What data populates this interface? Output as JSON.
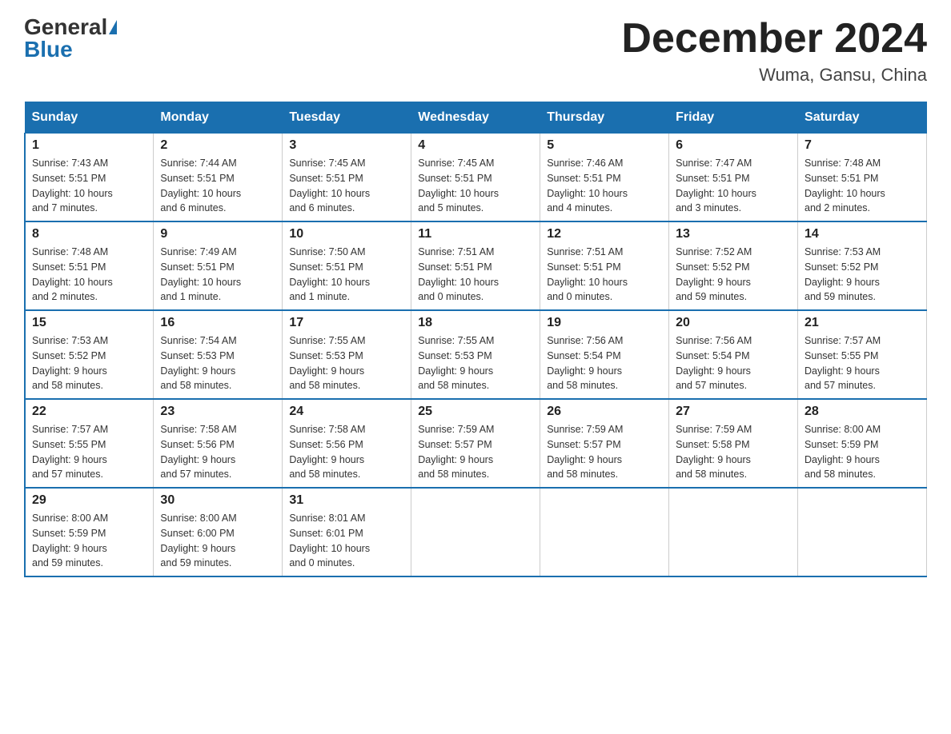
{
  "header": {
    "logo_general": "General",
    "logo_blue": "Blue",
    "month_year": "December 2024",
    "location": "Wuma, Gansu, China"
  },
  "days_of_week": [
    "Sunday",
    "Monday",
    "Tuesday",
    "Wednesday",
    "Thursday",
    "Friday",
    "Saturday"
  ],
  "weeks": [
    [
      {
        "day": "1",
        "info": "Sunrise: 7:43 AM\nSunset: 5:51 PM\nDaylight: 10 hours\nand 7 minutes."
      },
      {
        "day": "2",
        "info": "Sunrise: 7:44 AM\nSunset: 5:51 PM\nDaylight: 10 hours\nand 6 minutes."
      },
      {
        "day": "3",
        "info": "Sunrise: 7:45 AM\nSunset: 5:51 PM\nDaylight: 10 hours\nand 6 minutes."
      },
      {
        "day": "4",
        "info": "Sunrise: 7:45 AM\nSunset: 5:51 PM\nDaylight: 10 hours\nand 5 minutes."
      },
      {
        "day": "5",
        "info": "Sunrise: 7:46 AM\nSunset: 5:51 PM\nDaylight: 10 hours\nand 4 minutes."
      },
      {
        "day": "6",
        "info": "Sunrise: 7:47 AM\nSunset: 5:51 PM\nDaylight: 10 hours\nand 3 minutes."
      },
      {
        "day": "7",
        "info": "Sunrise: 7:48 AM\nSunset: 5:51 PM\nDaylight: 10 hours\nand 2 minutes."
      }
    ],
    [
      {
        "day": "8",
        "info": "Sunrise: 7:48 AM\nSunset: 5:51 PM\nDaylight: 10 hours\nand 2 minutes."
      },
      {
        "day": "9",
        "info": "Sunrise: 7:49 AM\nSunset: 5:51 PM\nDaylight: 10 hours\nand 1 minute."
      },
      {
        "day": "10",
        "info": "Sunrise: 7:50 AM\nSunset: 5:51 PM\nDaylight: 10 hours\nand 1 minute."
      },
      {
        "day": "11",
        "info": "Sunrise: 7:51 AM\nSunset: 5:51 PM\nDaylight: 10 hours\nand 0 minutes."
      },
      {
        "day": "12",
        "info": "Sunrise: 7:51 AM\nSunset: 5:51 PM\nDaylight: 10 hours\nand 0 minutes."
      },
      {
        "day": "13",
        "info": "Sunrise: 7:52 AM\nSunset: 5:52 PM\nDaylight: 9 hours\nand 59 minutes."
      },
      {
        "day": "14",
        "info": "Sunrise: 7:53 AM\nSunset: 5:52 PM\nDaylight: 9 hours\nand 59 minutes."
      }
    ],
    [
      {
        "day": "15",
        "info": "Sunrise: 7:53 AM\nSunset: 5:52 PM\nDaylight: 9 hours\nand 58 minutes."
      },
      {
        "day": "16",
        "info": "Sunrise: 7:54 AM\nSunset: 5:53 PM\nDaylight: 9 hours\nand 58 minutes."
      },
      {
        "day": "17",
        "info": "Sunrise: 7:55 AM\nSunset: 5:53 PM\nDaylight: 9 hours\nand 58 minutes."
      },
      {
        "day": "18",
        "info": "Sunrise: 7:55 AM\nSunset: 5:53 PM\nDaylight: 9 hours\nand 58 minutes."
      },
      {
        "day": "19",
        "info": "Sunrise: 7:56 AM\nSunset: 5:54 PM\nDaylight: 9 hours\nand 58 minutes."
      },
      {
        "day": "20",
        "info": "Sunrise: 7:56 AM\nSunset: 5:54 PM\nDaylight: 9 hours\nand 57 minutes."
      },
      {
        "day": "21",
        "info": "Sunrise: 7:57 AM\nSunset: 5:55 PM\nDaylight: 9 hours\nand 57 minutes."
      }
    ],
    [
      {
        "day": "22",
        "info": "Sunrise: 7:57 AM\nSunset: 5:55 PM\nDaylight: 9 hours\nand 57 minutes."
      },
      {
        "day": "23",
        "info": "Sunrise: 7:58 AM\nSunset: 5:56 PM\nDaylight: 9 hours\nand 57 minutes."
      },
      {
        "day": "24",
        "info": "Sunrise: 7:58 AM\nSunset: 5:56 PM\nDaylight: 9 hours\nand 58 minutes."
      },
      {
        "day": "25",
        "info": "Sunrise: 7:59 AM\nSunset: 5:57 PM\nDaylight: 9 hours\nand 58 minutes."
      },
      {
        "day": "26",
        "info": "Sunrise: 7:59 AM\nSunset: 5:57 PM\nDaylight: 9 hours\nand 58 minutes."
      },
      {
        "day": "27",
        "info": "Sunrise: 7:59 AM\nSunset: 5:58 PM\nDaylight: 9 hours\nand 58 minutes."
      },
      {
        "day": "28",
        "info": "Sunrise: 8:00 AM\nSunset: 5:59 PM\nDaylight: 9 hours\nand 58 minutes."
      }
    ],
    [
      {
        "day": "29",
        "info": "Sunrise: 8:00 AM\nSunset: 5:59 PM\nDaylight: 9 hours\nand 59 minutes."
      },
      {
        "day": "30",
        "info": "Sunrise: 8:00 AM\nSunset: 6:00 PM\nDaylight: 9 hours\nand 59 minutes."
      },
      {
        "day": "31",
        "info": "Sunrise: 8:01 AM\nSunset: 6:01 PM\nDaylight: 10 hours\nand 0 minutes."
      },
      {
        "day": "",
        "info": ""
      },
      {
        "day": "",
        "info": ""
      },
      {
        "day": "",
        "info": ""
      },
      {
        "day": "",
        "info": ""
      }
    ]
  ]
}
